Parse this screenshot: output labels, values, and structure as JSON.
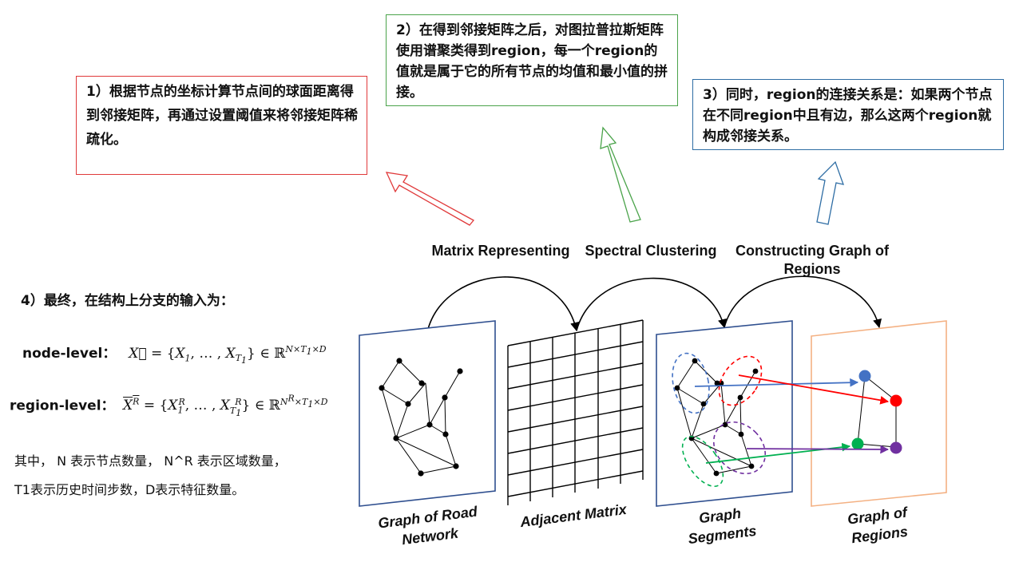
{
  "notes": {
    "note1": "1）根据节点的坐标计算节点间的球面距离得到邻接矩阵，再通过设置阈值来将邻接矩阵稀疏化。",
    "note2": "2）在得到邻接矩阵之后，对图拉普拉斯矩阵使用谱聚类得到region，每一个region的值就是属于它的所有节点的均值和最小值的拼接。",
    "note3": "3）同时，region的连接关系是：如果两个节点在不同region中且有边，那么这两个region就构成邻接关系。"
  },
  "steps": {
    "matrix_representing": "Matrix Representing",
    "spectral_clustering": "Spectral Clustering",
    "constructing_graph": "Constructing Graph of Regions"
  },
  "panels": {
    "road_network": "Graph of Road Network",
    "adjacent_matrix": "Adjacent Matrix",
    "graph_segments": "Graph Segments",
    "graph_of_regions": "Graph of Regions"
  },
  "final": {
    "title": "4）最终，在结构上分支的输入为：",
    "node_level_label": "node-level：",
    "region_level_label": "region-level：",
    "explanation_line1": "其中， N 表示节点数量， N^R 表示区域数量，",
    "explanation_line2": "T1表示历史时间步数，D表示特征数量。"
  },
  "colors": {
    "red": "#e0393a",
    "green": "#4aa34a",
    "blue": "#2e6da4",
    "orange": "#f4b183",
    "panel_border": "#2f4f8f",
    "region_blue": "#4472c4",
    "region_red": "#ff0000",
    "region_green": "#00b050",
    "region_purple": "#7030a0"
  }
}
